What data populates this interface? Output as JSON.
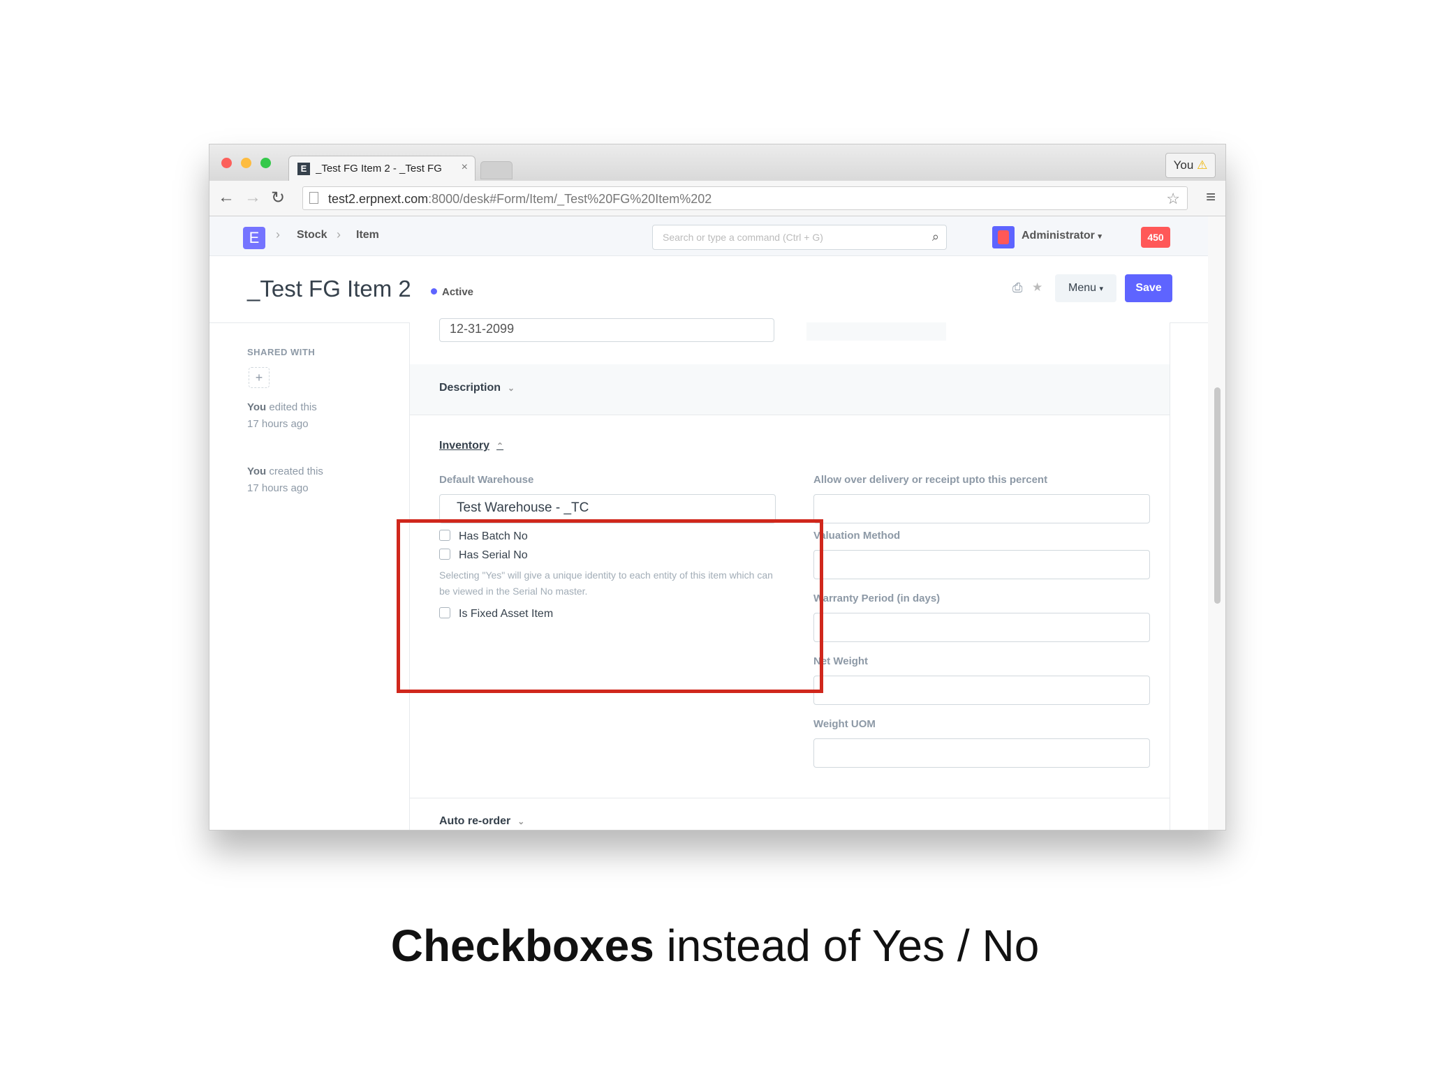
{
  "browser": {
    "tab_title": "_Test FG Item 2 - _Test FG",
    "tab_favicon": "E",
    "profile_label": "You",
    "url_host": "test2.erpnext.com",
    "url_path": ":8000/desk#Form/Item/_Test%20FG%20Item%202"
  },
  "navbar": {
    "logo": "E",
    "breadcrumbs": [
      "Stock",
      "Item"
    ],
    "search_placeholder": "Search or type a command (Ctrl + G)",
    "user": "Administrator",
    "notifications": "450"
  },
  "page": {
    "title": "_Test FG Item 2",
    "status": "Active",
    "menu_label": "Menu",
    "save_label": "Save"
  },
  "sidebar": {
    "shared_with": "SHARED WITH",
    "add": "+",
    "edited_by": "You",
    "edited_text": "edited this",
    "edited_time": "17 hours ago",
    "created_by": "You",
    "created_text": "created this",
    "created_time": "17 hours ago"
  },
  "form": {
    "end_of_life_value": "12-31-2099",
    "section_description": "Description",
    "section_inventory": "Inventory",
    "default_warehouse_label": "Default Warehouse",
    "default_warehouse_value": "Test Warehouse - _TC",
    "has_batch_no": "Has Batch No",
    "has_serial_no": "Has Serial No",
    "serial_help": "Selecting \"Yes\" will give a unique identity to each entity of this item which can be viewed in the Serial No master.",
    "is_fixed_asset": "Is Fixed Asset Item",
    "allowance_label": "Allow over delivery or receipt upto this percent",
    "valuation_label": "Valuation Method",
    "warranty_label": "Warranty Period (in days)",
    "net_weight_label": "Net Weight",
    "weight_uom_label": "Weight UOM",
    "section_reorder": "Auto re-order"
  },
  "caption": {
    "bold": "Checkboxes",
    "rest": " instead of Yes / No"
  },
  "colors": {
    "primary": "#5e64ff",
    "highlight": "#d0271c",
    "notification": "#ff5858"
  }
}
